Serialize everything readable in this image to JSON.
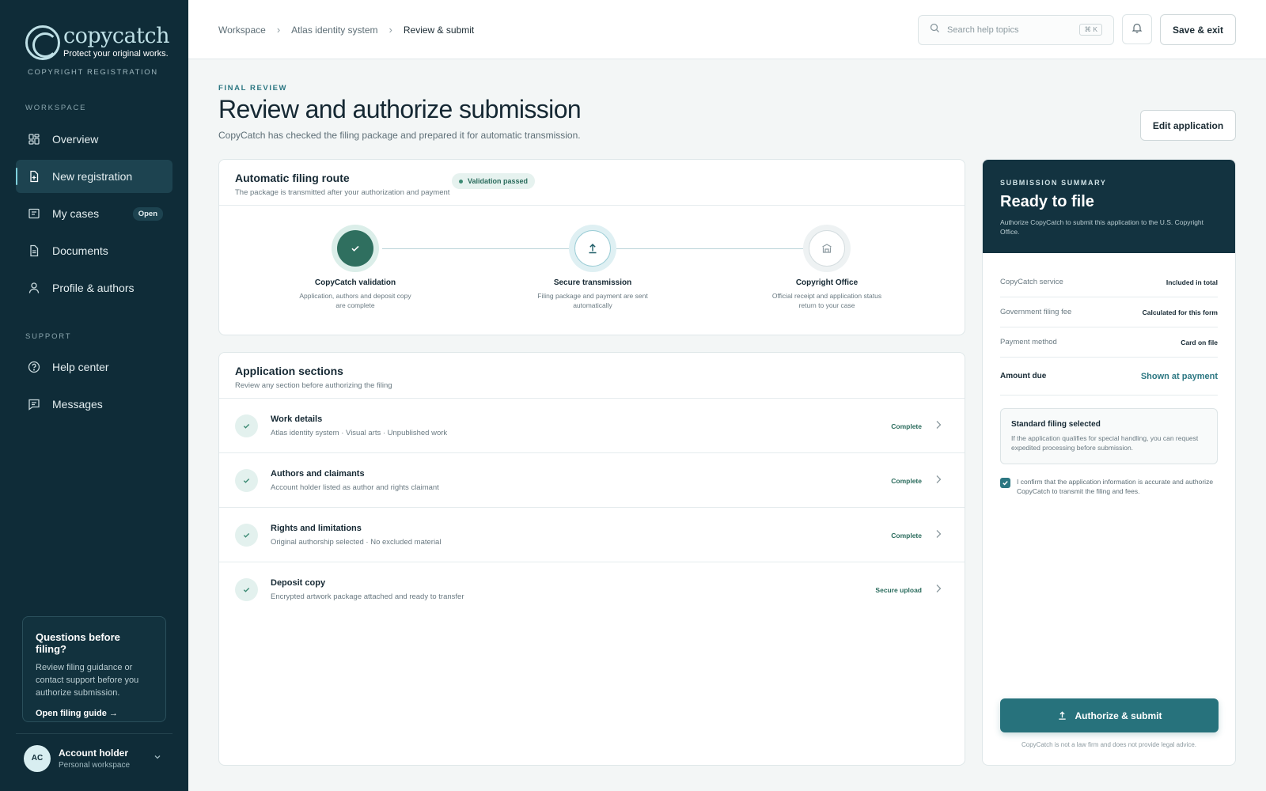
{
  "brand": {
    "name": "copycatch",
    "tagline": "Protect your original works.",
    "subtitle": "COPYRIGHT REGISTRATION"
  },
  "sidebar": {
    "workspace_heading": "WORKSPACE",
    "items": [
      {
        "label": "Overview",
        "icon": "dashboard-icon"
      },
      {
        "label": "New registration",
        "icon": "file-plus-icon",
        "active": true
      },
      {
        "label": "My cases",
        "icon": "cases-icon",
        "badge": "Open"
      },
      {
        "label": "Documents",
        "icon": "document-icon"
      },
      {
        "label": "Profile & authors",
        "icon": "user-icon"
      }
    ],
    "support_heading": "SUPPORT",
    "support_items": [
      {
        "label": "Help center",
        "icon": "help-icon"
      },
      {
        "label": "Messages",
        "icon": "message-icon"
      }
    ],
    "help_card": {
      "title": "Questions before filing?",
      "text": "Review filing guidance or contact support before you authorize submission.",
      "link": "Open filing guide →"
    },
    "account": {
      "initials": "AC",
      "name": "Account holder",
      "sub": "Personal workspace"
    }
  },
  "topbar": {
    "breadcrumbs": [
      "Workspace",
      "Atlas identity system",
      "Review & submit"
    ],
    "search_placeholder": "Search help topics",
    "search_shortcut": "⌘ K",
    "save_exit": "Save & exit"
  },
  "header": {
    "eyebrow": "FINAL REVIEW",
    "title": "Review and authorize submission",
    "subtitle": "CopyCatch has checked the filing package and prepared it for automatic transmission.",
    "edit_button": "Edit application"
  },
  "route": {
    "title": "Automatic filing route",
    "subtitle": "The package is transmitted after your authorization and payment",
    "status": "Validation passed",
    "steps": [
      {
        "label": "CopyCatch validation",
        "desc": "Application, authors and deposit copy are complete",
        "state": "done"
      },
      {
        "label": "Secure transmission",
        "desc": "Filing package and payment are sent automatically",
        "state": "active"
      },
      {
        "label": "Copyright Office",
        "desc": "Official receipt and application status return to your case",
        "state": "pending"
      }
    ]
  },
  "sections": {
    "title": "Application sections",
    "subtitle": "Review any section before authorizing the filing",
    "rows": [
      {
        "title": "Work details",
        "sub": "Atlas identity system · Visual arts · Unpublished work",
        "status": "Complete"
      },
      {
        "title": "Authors and claimants",
        "sub": "Account holder listed as author and rights claimant",
        "status": "Complete"
      },
      {
        "title": "Rights and limitations",
        "sub": "Original authorship selected · No excluded material",
        "status": "Complete"
      },
      {
        "title": "Deposit copy",
        "sub": "Encrypted artwork package attached and ready to transfer",
        "status": "Secure upload"
      }
    ]
  },
  "summary": {
    "eyebrow": "SUBMISSION SUMMARY",
    "title": "Ready to file",
    "desc": "Authorize CopyCatch to submit this application to the U.S. Copyright Office.",
    "rows": [
      {
        "k": "CopyCatch service",
        "v": "Included in total"
      },
      {
        "k": "Government filing fee",
        "v": "Calculated for this form"
      },
      {
        "k": "Payment method",
        "v": "Card on file"
      }
    ],
    "total": {
      "k": "Amount due",
      "v": "Shown at payment"
    },
    "standard": {
      "title": "Standard filing selected",
      "desc": "If the application qualifies for special handling, you can request expedited processing before submission."
    },
    "confirm": "I confirm that the application information is accurate and authorize CopyCatch to transmit the filing and fees.",
    "confirm_checked": true,
    "button": "Authorize & submit",
    "disclaimer": "CopyCatch is not a law firm and does not provide legal advice."
  },
  "colors": {
    "sidebar": "#0f2c38",
    "accent": "#27727c",
    "success": "#2f6f5f"
  }
}
